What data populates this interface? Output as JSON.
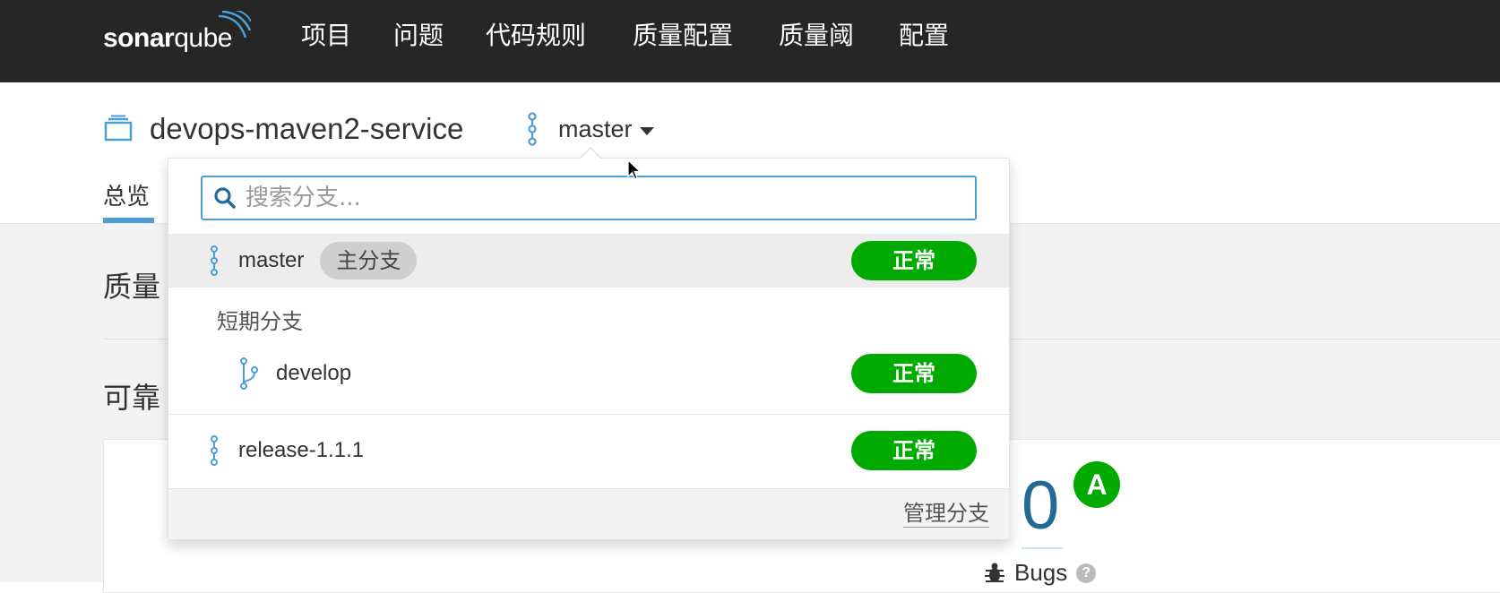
{
  "nav": {
    "logo_bold": "sonar",
    "logo_light": "qube",
    "items": [
      "项目",
      "问题",
      "代码规则",
      "质量配置",
      "质量阈",
      "配置"
    ]
  },
  "component": {
    "name": "devops-maven2-service",
    "branch": "master"
  },
  "tabs": {
    "overview": "总览"
  },
  "sections": {
    "quality_gate": "质量",
    "reliability": "可靠"
  },
  "measure": {
    "value": "0",
    "rating": "A",
    "label": "Bugs",
    "help": "?"
  },
  "dropdown": {
    "search_placeholder": "搜索分支...",
    "main_branch": {
      "name": "master",
      "tag": "主分支",
      "status": "正常"
    },
    "short_group_label": "短期分支",
    "short_branches": [
      {
        "name": "develop",
        "status": "正常"
      }
    ],
    "long_branches": [
      {
        "name": "release-1.1.1",
        "status": "正常"
      }
    ],
    "manage_label": "管理分支"
  },
  "colors": {
    "topbar": "#262626",
    "accent": "#4b9fd5",
    "status_ok": "#00aa00"
  },
  "icons": {
    "project": "project-icon",
    "branch_long": "long-branch-icon",
    "branch_short": "short-branch-icon",
    "search": "search-icon",
    "bug": "bug-icon"
  }
}
